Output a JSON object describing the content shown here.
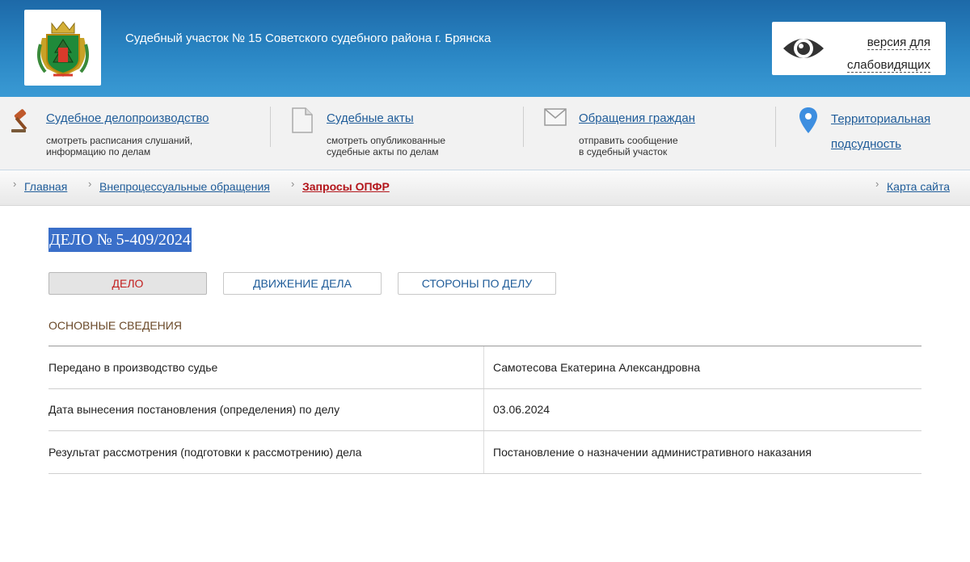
{
  "header": {
    "title": "Судебный участок № 15 Советского судебного района г. Брянска",
    "vision_link": "версия для слабовидящих"
  },
  "features": [
    {
      "icon": "gavel-icon",
      "label": "Судебное делопроизводство",
      "desc_line1": "смотреть расписания слушаний,",
      "desc_line2": "информацию по делам"
    },
    {
      "icon": "document-icon",
      "label": "Судебные акты",
      "desc_line1": "смотреть опубликованные",
      "desc_line2": "судебные акты по делам"
    },
    {
      "icon": "envelope-icon",
      "label": "Обращения граждан",
      "desc_line1": "отправить сообщение",
      "desc_line2": "в судебный участок"
    },
    {
      "icon": "map-pin-icon",
      "label_line1": "Территориальная",
      "label_line2": "подсудность"
    }
  ],
  "breadcrumb": {
    "items": [
      "Главная",
      "Внепроцессуальные обращения",
      "Запросы ОПФР"
    ],
    "sitemap": "Карта сайта"
  },
  "case": {
    "title": "ДЕЛО № 5-409/2024",
    "tabs": [
      "ДЕЛО",
      "ДВИЖЕНИЕ ДЕЛА",
      "СТОРОНЫ ПО ДЕЛУ"
    ],
    "active_tab": "ДЕЛО",
    "section_heading": "ОСНОВНЫЕ СВЕДЕНИЯ",
    "rows": [
      {
        "label": "Передано в производство судье",
        "value": "Самотесова Екатерина Александровна"
      },
      {
        "label": "Дата вынесения постановления (определения) по делу",
        "value": "03.06.2024"
      },
      {
        "label": "Результат рассмотрения (подготовки к рассмотрению) дела",
        "value": "Постановление о назначении административного наказания"
      }
    ]
  },
  "colors": {
    "header_blue": "#2a86c4",
    "link_blue": "#1f5c99",
    "active_red": "#b3151b",
    "selection_blue": "#3a6fc9"
  }
}
